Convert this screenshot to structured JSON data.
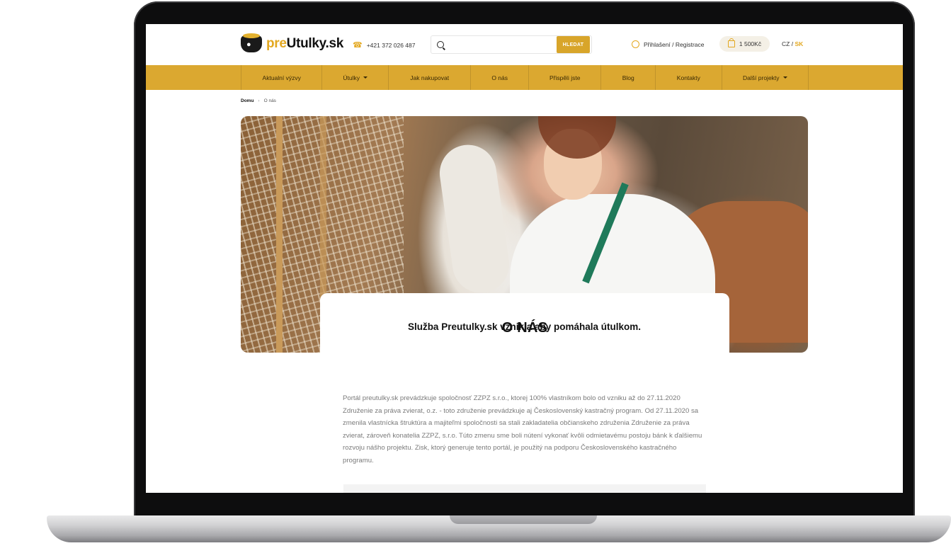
{
  "header": {
    "logo": {
      "prefix": "pre",
      "name": "Utulky.sk"
    },
    "phone": "+421 372 026 487",
    "search": {
      "placeholder": "",
      "button_label": "HLEDAT"
    },
    "login_label": "Přihlašení / Registrace",
    "cart_label": "1 500Kč",
    "lang": {
      "cz": "CZ",
      "separator": "/",
      "sk": "SK",
      "active": "SK"
    }
  },
  "nav": {
    "items": [
      {
        "label": "Aktualní výzvy"
      },
      {
        "label": "Útulky",
        "dropdown": true
      },
      {
        "label": "Jak nakupovat"
      },
      {
        "label": "O nás"
      },
      {
        "label": "Přispěli jste"
      },
      {
        "label": "Blog"
      },
      {
        "label": "Kontakty"
      },
      {
        "label": "Další projekty",
        "dropdown": true
      }
    ]
  },
  "breadcrumb": {
    "home": "Domu",
    "current": "O nás"
  },
  "page": {
    "title": "O NÁS",
    "subtitle": "Služba Preutulky.sk vznikla aby pomáhala útulkom.",
    "body": "Portál preutulky.sk prevádzkuje spoločnosť ZZPZ s.r.o., ktorej 100% vlastníkom bolo od vzniku až do 27.11.2020 Združenie za práva zvierat, o.z. - toto združenie prevádzkuje aj Československý kastračný program. Od 27.11.2020 sa zmenila vlastnícka štruktúra a majiteľmi spoločnosti sa stali zakladatelia občianskeho združenia Združenie za práva zvierat, zároveň konatelia ZZPZ, s.r.o. Túto zmenu sme boli nútení vykonať kvôli odmietavému postoju bánk k ďalšiemu rozvoju nášho projektu. Zisk, ktorý generuje tento portál, je použitý na podporu Československého kastračného programu."
  },
  "icons": {
    "logo": "bowl-paw-icon",
    "phone": "phone-icon",
    "search": "search-icon",
    "user": "user-circle-icon",
    "cart": "shopping-bag-icon",
    "dropdown": "caret-down-icon",
    "breadcrumb_separator": "chevron-right-icon"
  },
  "colors": {
    "accent": "#dba830",
    "accent_text": "#e3a820",
    "frame": "#0d0d0e"
  }
}
